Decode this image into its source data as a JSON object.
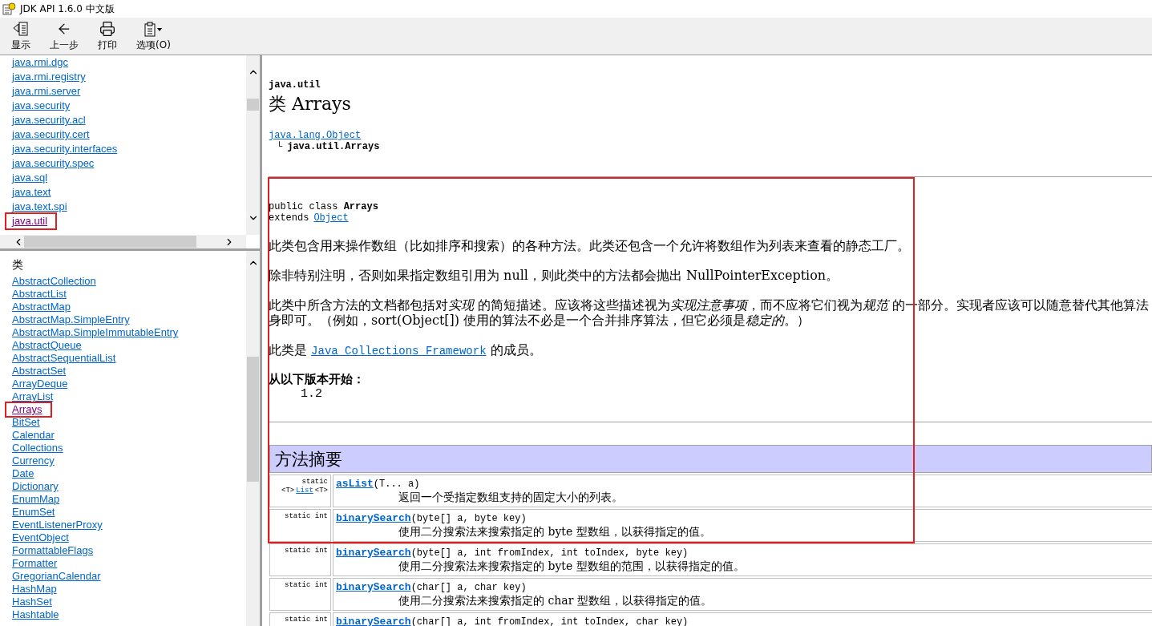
{
  "window": {
    "title": "JDK API 1.6.0 中文版"
  },
  "toolbar": [
    {
      "label": "显示",
      "kind": "show"
    },
    {
      "label": "上一步",
      "kind": "back"
    },
    {
      "label": "打印",
      "kind": "print"
    },
    {
      "label": "选项(O)",
      "kind": "options"
    }
  ],
  "packages": [
    {
      "label": "java.rmi.dgc",
      "selected": false
    },
    {
      "label": "java.rmi.registry",
      "selected": false
    },
    {
      "label": "java.rmi.server",
      "selected": false
    },
    {
      "label": "java.security",
      "selected": false
    },
    {
      "label": "java.security.acl",
      "selected": false
    },
    {
      "label": "java.security.cert",
      "selected": false
    },
    {
      "label": "java.security.interfaces",
      "selected": false
    },
    {
      "label": "java.security.spec",
      "selected": false
    },
    {
      "label": "java.sql",
      "selected": false
    },
    {
      "label": "java.text",
      "selected": false
    },
    {
      "label": "java.text.spi",
      "selected": false
    },
    {
      "label": "java.util",
      "selected": true
    }
  ],
  "classes": {
    "heading": "类",
    "items": [
      {
        "label": "AbstractCollection",
        "selected": false
      },
      {
        "label": "AbstractList",
        "selected": false
      },
      {
        "label": "AbstractMap",
        "selected": false
      },
      {
        "label": "AbstractMap.SimpleEntry",
        "selected": false
      },
      {
        "label": "AbstractMap.SimpleImmutableEntry",
        "selected": false
      },
      {
        "label": "AbstractQueue",
        "selected": false
      },
      {
        "label": "AbstractSequentialList",
        "selected": false
      },
      {
        "label": "AbstractSet",
        "selected": false
      },
      {
        "label": "ArrayDeque",
        "selected": false
      },
      {
        "label": "ArrayList",
        "selected": false
      },
      {
        "label": "Arrays",
        "selected": true
      },
      {
        "label": "BitSet",
        "selected": false
      },
      {
        "label": "Calendar",
        "selected": false
      },
      {
        "label": "Collections",
        "selected": false
      },
      {
        "label": "Currency",
        "selected": false
      },
      {
        "label": "Date",
        "selected": false
      },
      {
        "label": "Dictionary",
        "selected": false
      },
      {
        "label": "EnumMap",
        "selected": false
      },
      {
        "label": "EnumSet",
        "selected": false
      },
      {
        "label": "EventListenerProxy",
        "selected": false
      },
      {
        "label": "EventObject",
        "selected": false
      },
      {
        "label": "FormattableFlags",
        "selected": false
      },
      {
        "label": "Formatter",
        "selected": false
      },
      {
        "label": "GregorianCalendar",
        "selected": false
      },
      {
        "label": "HashMap",
        "selected": false
      },
      {
        "label": "HashSet",
        "selected": false
      },
      {
        "label": "Hashtable",
        "selected": false
      }
    ]
  },
  "content": {
    "package_name": "java.util",
    "title": "类 Arrays",
    "hierarchy": {
      "parent": "java.lang.Object",
      "branch": "└",
      "self": "java.util.Arrays"
    },
    "declaration": {
      "signature": "public class **Arrays**",
      "extends_label": "extends",
      "extends_link": "Object"
    },
    "paragraphs": [
      [
        [
          {
            "text": "此类包含用来操作数组（比如排序和搜索）的各种方法。此类还包含一个允许将数组作为列表来查看的静态工厂。",
            "em": false
          }
        ]
      ],
      [
        [
          {
            "text": "除非特别注明，否则如果指定数组引用为 null，则此类中的方法都会抛出 NullPointerException。",
            "em": false
          }
        ]
      ],
      [
        [
          {
            "text": "此类中所含方法的文档都包括对",
            "em": false
          },
          {
            "text": "实现",
            "em": true
          },
          {
            "text": " 的简短描述。应该将这些描述视为",
            "em": false
          },
          {
            "text": "实现注意事项",
            "em": true
          },
          {
            "text": "，而不应将它们视为",
            "em": false
          },
          {
            "text": "规范",
            "em": true
          },
          {
            "text": " 的一部分。实现者应该可以随意替代其他算法",
            "em": false
          }
        ],
        [
          {
            "text": "身即可。（例如，sort(Object[]) 使用的算法不必是一个合并排序算法，但它必须是",
            "em": false
          },
          {
            "text": "稳定的",
            "em": true
          },
          {
            "text": "。）",
            "em": false
          }
        ]
      ]
    ],
    "member_of": {
      "before": "此类是",
      "link": "Java Collections Framework",
      "after": "的成员。"
    },
    "since": {
      "label": "从以下版本开始：",
      "value": "1.2"
    },
    "method_summary": {
      "heading": "方法摘要",
      "rows": [
        {
          "modifier": "static",
          "type_param": {
            "before": "<T>",
            "link": "List",
            "after": "<T>"
          },
          "name": "asList",
          "params": "(T... a)",
          "description": "返回一个受指定数组支持的固定大小的列表。"
        },
        {
          "modifier": "static int",
          "name": "binarySearch",
          "params": "(byte[] a, byte key)",
          "description": "使用二分搜索法来搜索指定的 byte 型数组，以获得指定的值。"
        },
        {
          "modifier": "static int",
          "name": "binarySearch",
          "params": "(byte[] a, int fromIndex, int toIndex, byte key)",
          "description": "使用二分搜索法来搜索指定的 byte 型数组的范围，以获得指定的值。"
        },
        {
          "modifier": "static int",
          "name": "binarySearch",
          "params": "(char[] a, char key)",
          "description": "使用二分搜索法来搜索指定的 char 型数组，以获得指定的值。"
        },
        {
          "modifier": "static int",
          "name": "binarySearch",
          "params": "(char[] a, int fromIndex, int toIndex, char key)"
        }
      ]
    }
  }
}
